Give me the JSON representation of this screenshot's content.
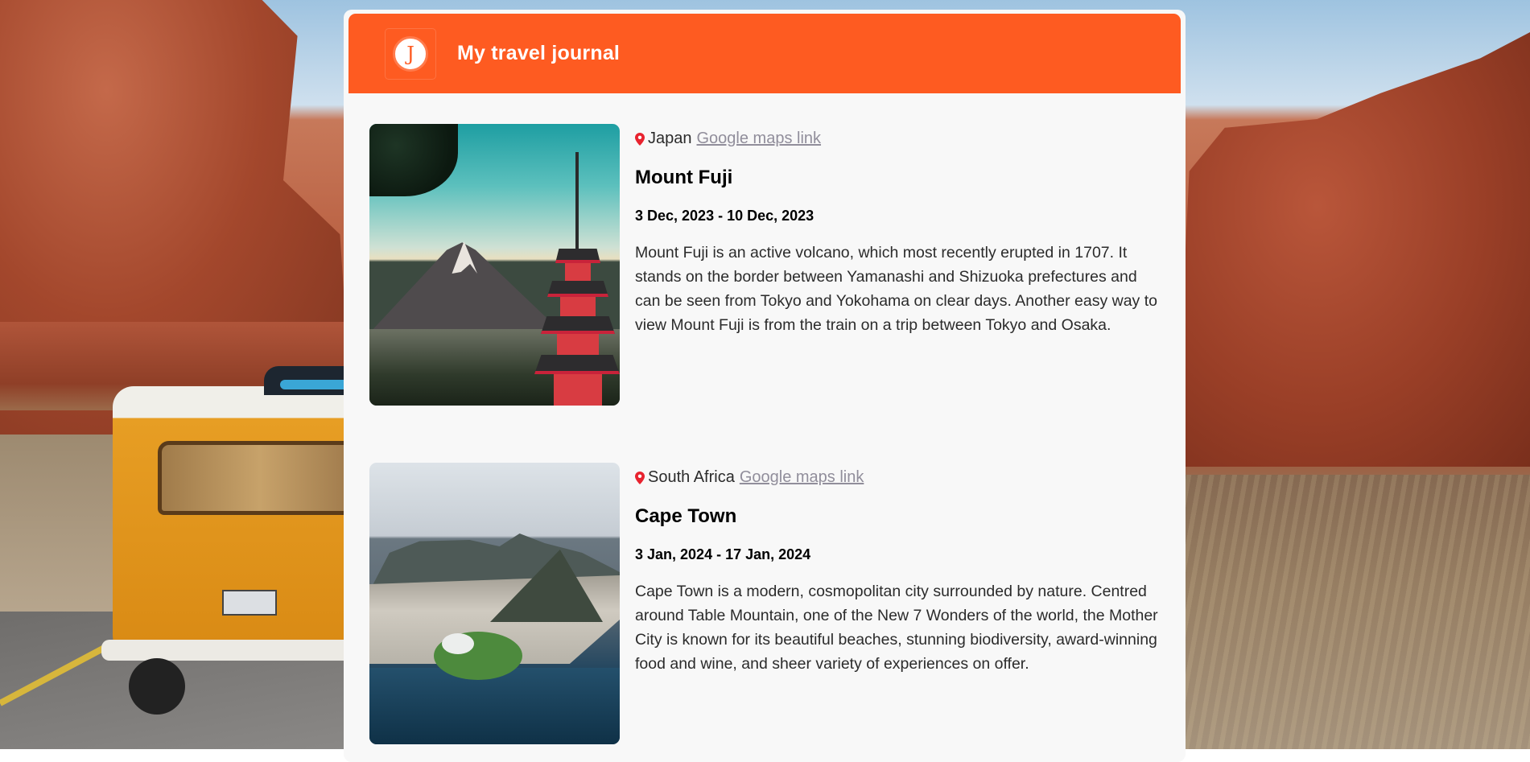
{
  "header": {
    "logo_letter": "J",
    "title": "My travel journal",
    "accent_color": "#fe5b21"
  },
  "entries": [
    {
      "country": "Japan",
      "maps_link_label": "Google maps link",
      "place": "Mount Fuji",
      "dates": "3 Dec, 2023 - 10 Dec, 2023",
      "description": "Mount Fuji is an active volcano, which most recently erupted in 1707. It stands on the border between Yamanashi and Shizuoka prefectures and can be seen from Tokyo and Yokohama on clear days. Another easy way to view Mount Fuji is from the train on a trip between Tokyo and Osaka.",
      "photo_icon": "mount-fuji-photo"
    },
    {
      "country": "South Africa",
      "maps_link_label": "Google maps link",
      "place": "Cape Town",
      "dates": "3 Jan, 2024 - 17 Jan, 2024",
      "description": "Cape Town is a modern, cosmopolitan city surrounded by nature. Centred around Table Mountain, one of the New 7 Wonders of the world, the Mother City is known for its beautiful beaches, stunning biodiversity, award-winning food and wine, and sheer variety of experiences on offer.",
      "photo_icon": "cape-town-photo"
    }
  ],
  "colors": {
    "pin": "#e8232f",
    "link": "#918e9b",
    "card_bg": "#f8f8f8"
  }
}
